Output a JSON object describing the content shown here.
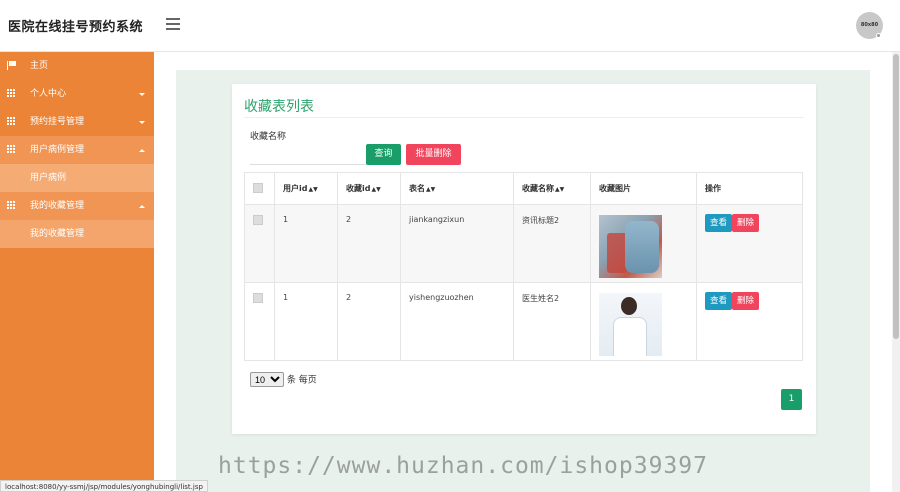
{
  "app": {
    "title": "医院在线挂号预约系统",
    "avatar_text": "80x80"
  },
  "sidebar": {
    "items": [
      {
        "label": "主页",
        "icon": "flag-icon"
      },
      {
        "label": "个人中心",
        "icon": "grid-icon"
      },
      {
        "label": "预约挂号管理",
        "icon": "grid-icon"
      },
      {
        "label": "用户病例管理",
        "icon": "grid-icon",
        "expanded": true,
        "children": [
          {
            "label": "用户病例"
          }
        ]
      },
      {
        "label": "我的收藏管理",
        "icon": "grid-icon",
        "expanded": true,
        "children": [
          {
            "label": "我的收藏管理"
          }
        ]
      }
    ]
  },
  "main": {
    "title": "收藏表列表",
    "search": {
      "label": "收藏名称",
      "value": "",
      "placeholder": ""
    },
    "buttons": {
      "search": "查询",
      "batch_delete": "批量删除"
    },
    "table": {
      "columns": [
        "用户id",
        "收藏id",
        "表名",
        "收藏名称",
        "收藏图片",
        "操作"
      ],
      "rows": [
        {
          "user_id": "1",
          "fav_id": "2",
          "table_name": "jiankangzixun",
          "fav_name": "资讯标题2",
          "image": "medical-image"
        },
        {
          "user_id": "1",
          "fav_id": "2",
          "table_name": "yishengzuozhen",
          "fav_name": "医生姓名2",
          "image": "doctor-image"
        }
      ],
      "actions": {
        "view": "查看",
        "delete": "删除"
      }
    },
    "pager": {
      "page_size": "10",
      "page_size_options": [
        "10"
      ],
      "per_page_label": "条 每页",
      "current_page": "1"
    }
  },
  "statusbar": {
    "url": "localhost:8080/yy-ssmj/jsp/modules/yonghubingli/list.jsp"
  },
  "watermark": "https://www.huzhan.com/ishop39397",
  "colors": {
    "sidebar": "#ec8437",
    "accent_green": "#199e6a",
    "danger": "#f0455c",
    "info": "#1e9ac0",
    "title_green": "#2ca36b"
  }
}
